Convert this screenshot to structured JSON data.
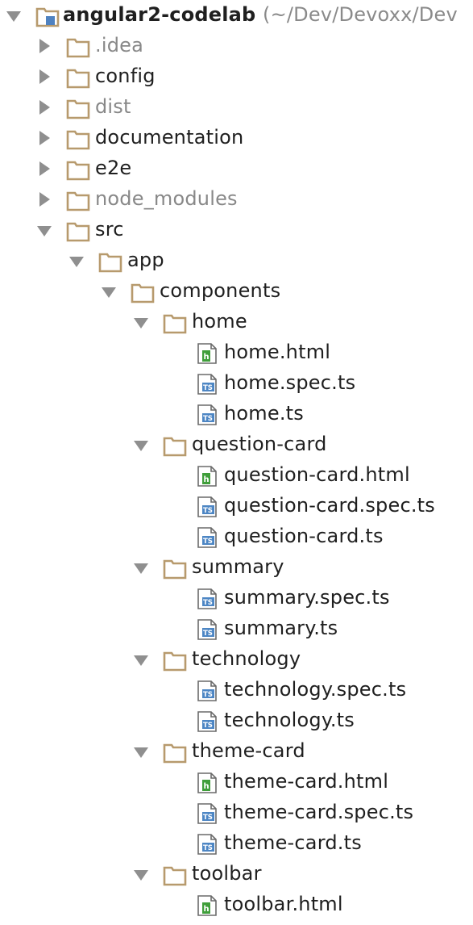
{
  "colors": {
    "folder_stroke": "#b79a6d",
    "arrow": "#8f8f8f",
    "text": "#1f1f1f",
    "muted_text": "#888888",
    "ts_icon": "#4d86c4",
    "html_icon": "#3f9e3a"
  },
  "tree": {
    "root": {
      "name": "angular2-codelab",
      "path": "(~/Dev/Devoxx/Dev",
      "icon": "project-folder-icon",
      "expanded": true
    },
    "items": [
      {
        "label": ".idea",
        "type": "folder",
        "expanded": false,
        "muted": true
      },
      {
        "label": "config",
        "type": "folder",
        "expanded": false,
        "muted": false
      },
      {
        "label": "dist",
        "type": "folder",
        "expanded": false,
        "muted": true
      },
      {
        "label": "documentation",
        "type": "folder",
        "expanded": false,
        "muted": false
      },
      {
        "label": "e2e",
        "type": "folder",
        "expanded": false,
        "muted": false
      },
      {
        "label": "node_modules",
        "type": "folder",
        "expanded": false,
        "muted": true
      },
      {
        "label": "src",
        "type": "folder",
        "expanded": true,
        "muted": false
      },
      {
        "label": "app",
        "type": "folder",
        "expanded": true,
        "muted": false
      },
      {
        "label": "components",
        "type": "folder",
        "expanded": true,
        "muted": false
      },
      {
        "label": "home",
        "type": "folder",
        "expanded": true,
        "muted": false
      },
      {
        "label": "home.html",
        "type": "html-file",
        "muted": false
      },
      {
        "label": "home.spec.ts",
        "type": "ts-file",
        "muted": false
      },
      {
        "label": "home.ts",
        "type": "ts-file",
        "muted": false
      },
      {
        "label": "question-card",
        "type": "folder",
        "expanded": true,
        "muted": false
      },
      {
        "label": "question-card.html",
        "type": "html-file",
        "muted": false
      },
      {
        "label": "question-card.spec.ts",
        "type": "ts-file",
        "muted": false
      },
      {
        "label": "question-card.ts",
        "type": "ts-file",
        "muted": false
      },
      {
        "label": "summary",
        "type": "folder",
        "expanded": true,
        "muted": false
      },
      {
        "label": "summary.spec.ts",
        "type": "ts-file",
        "muted": false
      },
      {
        "label": "summary.ts",
        "type": "ts-file",
        "muted": false
      },
      {
        "label": "technology",
        "type": "folder",
        "expanded": true,
        "muted": false
      },
      {
        "label": "technology.spec.ts",
        "type": "ts-file",
        "muted": false
      },
      {
        "label": "technology.ts",
        "type": "ts-file",
        "muted": false
      },
      {
        "label": "theme-card",
        "type": "folder",
        "expanded": true,
        "muted": false
      },
      {
        "label": "theme-card.html",
        "type": "html-file",
        "muted": false
      },
      {
        "label": "theme-card.spec.ts",
        "type": "ts-file",
        "muted": false
      },
      {
        "label": "theme-card.ts",
        "type": "ts-file",
        "muted": false
      },
      {
        "label": "toolbar",
        "type": "folder",
        "expanded": true,
        "muted": false
      },
      {
        "label": "toolbar.html",
        "type": "html-file",
        "muted": false
      }
    ]
  }
}
